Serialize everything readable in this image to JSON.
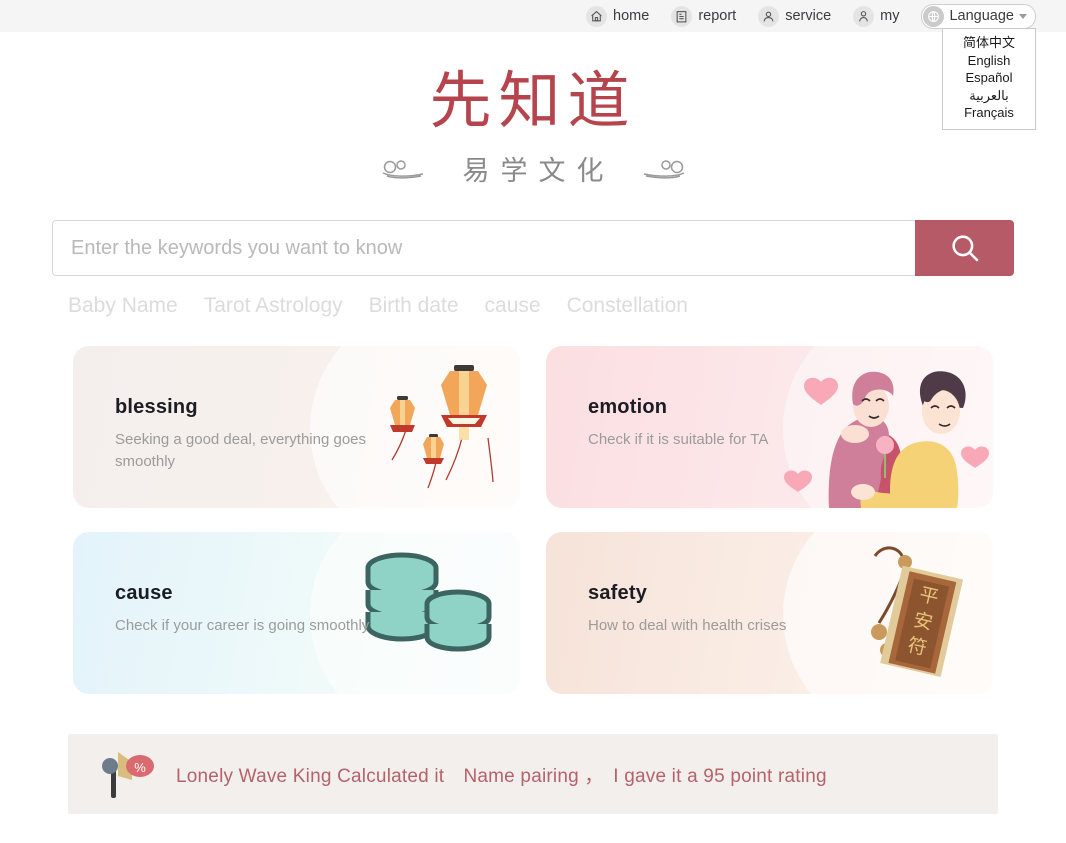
{
  "topnav": {
    "items": [
      {
        "label": "home",
        "icon": "home-icon"
      },
      {
        "label": "report",
        "icon": "report-icon"
      },
      {
        "label": "service",
        "icon": "service-icon"
      },
      {
        "label": "my",
        "icon": "user-icon"
      }
    ],
    "language": {
      "label": "Language",
      "icon": "globe-icon",
      "caret": "chevron-down-icon",
      "options": [
        "简体中文",
        "English",
        "Español",
        "بالعربية",
        "Français"
      ]
    }
  },
  "logo": {
    "title": "先知道",
    "subtitle": "易学文化"
  },
  "search": {
    "placeholder": "Enter the keywords you want to know",
    "value": "",
    "button_icon": "search-icon"
  },
  "tags": [
    "Baby Name",
    "Tarot Astrology",
    "Birth date",
    "cause",
    "Constellation"
  ],
  "cards": [
    {
      "title": "blessing",
      "desc": "Seeking a good deal, everything goes smoothly",
      "art": "sky-lanterns-illustration"
    },
    {
      "title": "emotion",
      "desc": "Check if it is suitable for TA",
      "art": "couple-hug-illustration"
    },
    {
      "title": "cause",
      "desc": "Check if your career is going smoothly",
      "art": "coin-stacks-illustration"
    },
    {
      "title": "safety",
      "desc": "How to deal with health crises",
      "art": "peace-amulet-illustration"
    }
  ],
  "announcement": {
    "icon": "megaphone-icon",
    "badge": "%",
    "message": "Lonely Wave King Calculated it　Name pairing ，　I gave it a 95 point rating"
  },
  "colors": {
    "brand_red": "#b5444c",
    "search_button": "#b55a66",
    "announce_text": "#b5626a",
    "topbar_bg": "#f5f5f5"
  }
}
